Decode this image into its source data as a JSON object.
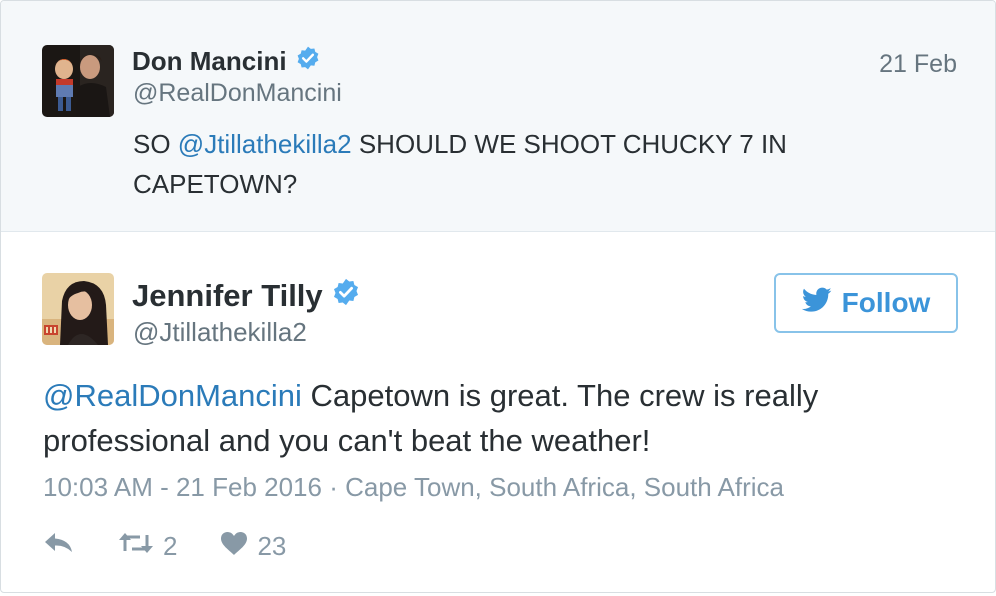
{
  "parent_tweet": {
    "author_name": "Don Mancini",
    "author_handle": "@RealDonMancini",
    "date": "21 Feb",
    "text_prefix": "SO ",
    "text_mention": "@Jtillathekilla2",
    "text_rest": " SHOULD WE SHOOT CHUCKY 7 IN CAPETOWN?"
  },
  "main_tweet": {
    "author_name": "Jennifer Tilly",
    "author_handle": "@Jtillathekilla2",
    "follow_label": "Follow",
    "text_mention": "@RealDonMancini",
    "text_rest": " Capetown is great. The crew is really professional and you can't beat the weather!",
    "timestamp": "10:03 AM - 21 Feb 2016",
    "separator": " · ",
    "location": "Cape Town, South Africa, South Africa",
    "retweet_count": "2",
    "like_count": "23"
  },
  "icons": {
    "verified": "verified-badge-icon",
    "twitter_bird": "twitter-bird-icon",
    "reply": "reply-icon",
    "retweet": "retweet-icon",
    "like": "heart-icon"
  },
  "colors": {
    "accent": "#2b7bb9",
    "verified": "#55acee",
    "muted": "#8899a6",
    "parent_bg": "#f5f8fa"
  }
}
